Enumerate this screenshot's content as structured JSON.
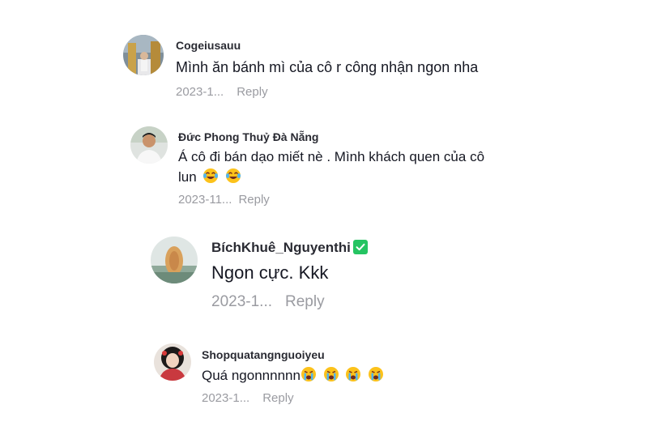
{
  "comments": [
    {
      "username": "Cogeiusauu",
      "text": "Mình ăn bánh mì của cô r công nhận ngon nha",
      "date": "2023-1...",
      "reply_label": "Reply"
    },
    {
      "username": "Đức Phong Thuỷ Đà Nẵng",
      "text_line1": "Á cô đi bán dạo miết nè . Mình khách quen của cô",
      "text_line2": "lun",
      "emojis": [
        "laughing-tears-emoji",
        "laughing-tears-emoji"
      ],
      "date": "2023-11...",
      "reply_label": "Reply"
    },
    {
      "username": "BíchKhuê_Nguyenthi",
      "verified": true,
      "text": "Ngon cực. Kkk",
      "date": "2023-1...",
      "reply_label": "Reply"
    },
    {
      "username": "Shopquatangnguoiyeu",
      "text": "Quá ngonnnnnn",
      "emojis": [
        "crying-emoji",
        "crying-emoji",
        "crying-emoji",
        "crying-emoji"
      ],
      "date": "2023-1...",
      "reply_label": "Reply"
    }
  ],
  "colors": {
    "username": "#2a2b33",
    "text": "#161823",
    "meta": "#9a9ba1",
    "verified": "#25c462"
  }
}
